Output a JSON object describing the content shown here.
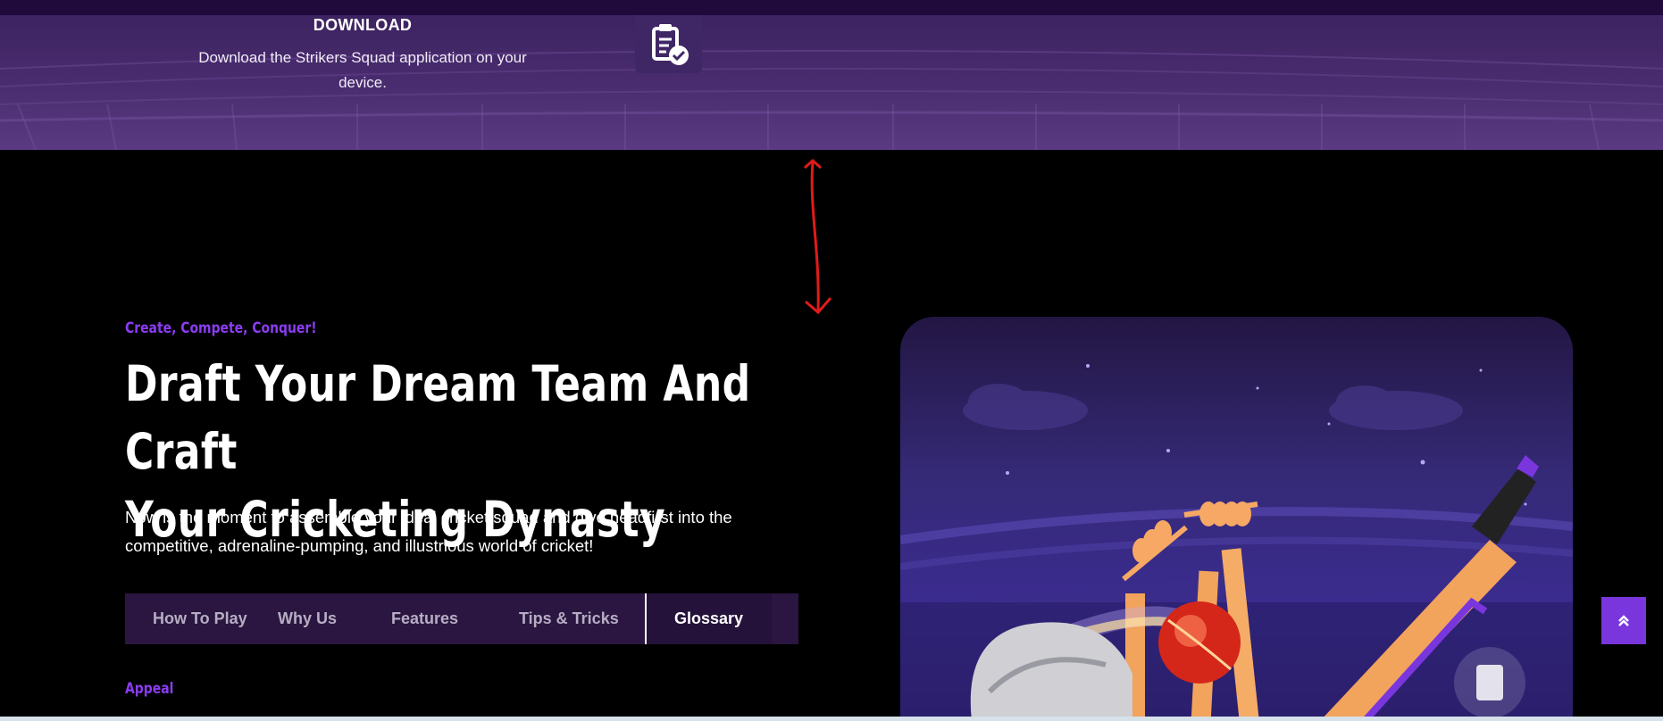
{
  "download": {
    "title": "DOWNLOAD",
    "text": "Download the Strikers Squad application on your device.",
    "icon": "clipboard-check-icon"
  },
  "hero": {
    "eyebrow": "Create, Compete, Conquer!",
    "headline_line1": "Draft Your Dream Team And Craft",
    "headline_line2": "Your Cricketing Dynasty",
    "lead": "Now is the moment to assemble your ideal cricket squad and dive headfirst into the competitive, adrenaline-pumping, and illustrious world of cricket!"
  },
  "tabs": [
    {
      "label": "How To Play"
    },
    {
      "label": "Why Us"
    },
    {
      "label": "Features"
    },
    {
      "label": "Tips & Tricks"
    },
    {
      "label": "Glossary",
      "active": true
    }
  ],
  "section": {
    "heading": "Appeal"
  },
  "scroll_top": {
    "icon": "double-chevron-up-icon"
  },
  "colors": {
    "accent": "#7a36dd",
    "eyebrow": "#8b3cf2",
    "tab_bar": "#2a1640",
    "top_band": "#4a2d70",
    "annotation": "#e01b1b"
  }
}
